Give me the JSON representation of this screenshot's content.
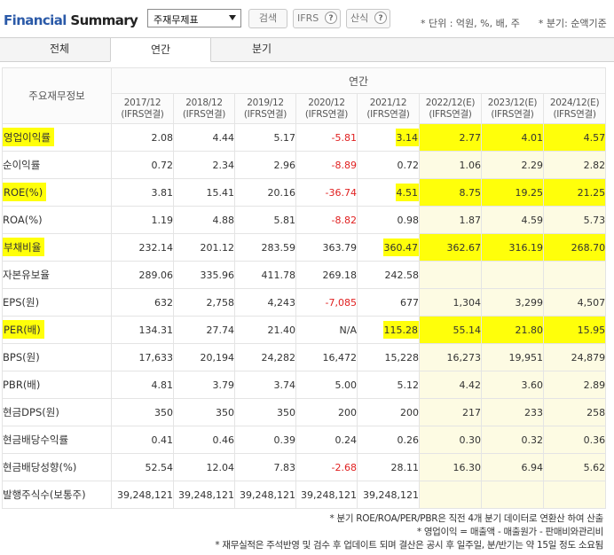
{
  "header": {
    "title_part1": "Financial",
    "title_part2": " Summary",
    "select_value": "주재무제표",
    "search_label": "검색",
    "ifrs_label": "IFRS",
    "calc_label": "산식",
    "help_glyph": "?",
    "unit_note": "* 단위 : 억원, %, 배, 주      * 분기: 순액기준"
  },
  "tabs": [
    {
      "label": "전체"
    },
    {
      "label": "연간"
    },
    {
      "label": "분기"
    }
  ],
  "table": {
    "row_header_label": "주요재무정보",
    "group_label": "연간",
    "periods": [
      {
        "year": "2017/12",
        "basis": "(IFRS연결)"
      },
      {
        "year": "2018/12",
        "basis": "(IFRS연결)"
      },
      {
        "year": "2019/12",
        "basis": "(IFRS연결)"
      },
      {
        "year": "2020/12",
        "basis": "(IFRS연결)"
      },
      {
        "year": "2021/12",
        "basis": "(IFRS연결)"
      },
      {
        "year": "2022/12(E)",
        "basis": "(IFRS연결)"
      },
      {
        "year": "2023/12(E)",
        "basis": "(IFRS연결)"
      },
      {
        "year": "2024/12(E)",
        "basis": "(IFRS연결)"
      }
    ],
    "rows": [
      {
        "label": "영업이익률",
        "highlight": true,
        "values": [
          "2.08",
          "4.44",
          "5.17",
          "-5.81",
          "3.14",
          "2.77",
          "4.01",
          "4.57"
        ]
      },
      {
        "label": "순이익률",
        "highlight": false,
        "values": [
          "0.72",
          "2.34",
          "2.96",
          "-8.89",
          "0.72",
          "1.06",
          "2.29",
          "2.82"
        ]
      },
      {
        "label": "ROE(%)",
        "highlight": true,
        "values": [
          "3.81",
          "15.41",
          "20.16",
          "-36.74",
          "4.51",
          "8.75",
          "19.25",
          "21.25"
        ]
      },
      {
        "label": "ROA(%)",
        "highlight": false,
        "values": [
          "1.19",
          "4.88",
          "5.81",
          "-8.82",
          "0.98",
          "1.87",
          "4.59",
          "5.73"
        ]
      },
      {
        "label": "부채비율",
        "highlight": true,
        "values": [
          "232.14",
          "201.12",
          "283.59",
          "363.79",
          "360.47",
          "362.67",
          "316.19",
          "268.70"
        ]
      },
      {
        "label": "자본유보율",
        "highlight": false,
        "values": [
          "289.06",
          "335.96",
          "411.78",
          "269.18",
          "242.58",
          "",
          "",
          ""
        ]
      },
      {
        "label": "EPS(원)",
        "highlight": false,
        "values": [
          "632",
          "2,758",
          "4,243",
          "-7,085",
          "677",
          "1,304",
          "3,299",
          "4,507"
        ]
      },
      {
        "label": "PER(배)",
        "highlight": true,
        "values": [
          "134.31",
          "27.74",
          "21.40",
          "N/A",
          "115.28",
          "55.14",
          "21.80",
          "15.95"
        ]
      },
      {
        "label": "BPS(원)",
        "highlight": false,
        "values": [
          "17,633",
          "20,194",
          "24,282",
          "16,472",
          "15,228",
          "16,273",
          "19,951",
          "24,879"
        ]
      },
      {
        "label": "PBR(배)",
        "highlight": false,
        "values": [
          "4.81",
          "3.79",
          "3.74",
          "5.00",
          "5.12",
          "4.42",
          "3.60",
          "2.89"
        ]
      },
      {
        "label": "현금DPS(원)",
        "highlight": false,
        "values": [
          "350",
          "350",
          "350",
          "200",
          "200",
          "217",
          "233",
          "258"
        ]
      },
      {
        "label": "현금배당수익률",
        "highlight": false,
        "values": [
          "0.41",
          "0.46",
          "0.39",
          "0.24",
          "0.26",
          "0.30",
          "0.32",
          "0.36"
        ]
      },
      {
        "label": "현금배당성향(%)",
        "highlight": false,
        "values": [
          "52.54",
          "12.04",
          "7.83",
          "-2.68",
          "28.11",
          "16.30",
          "6.94",
          "5.62"
        ]
      },
      {
        "label": "발행주식수(보통주)",
        "highlight": false,
        "values": [
          "39,248,121",
          "39,248,121",
          "39,248,121",
          "39,248,121",
          "39,248,121",
          "",
          "",
          ""
        ]
      }
    ]
  },
  "footnotes": [
    "* 분기 ROE/ROA/PER/PBR은 직전 4개 분기 데이터로 연환산 하여 산출",
    "* 영업이익 = 매출액 - 매출원가 - 판매비와관리비",
    "* 재무실적은 주석반영 및 검수 후 업데이트 되며 결산은 공시 후 일주일, 분/반기는 약 15일 정도 소요됨"
  ],
  "colors": {
    "highlight": "#ffff0a",
    "estimate_bg": "#fdfbe3",
    "negative": "#e02020",
    "title_blue": "#2b5aa8"
  }
}
